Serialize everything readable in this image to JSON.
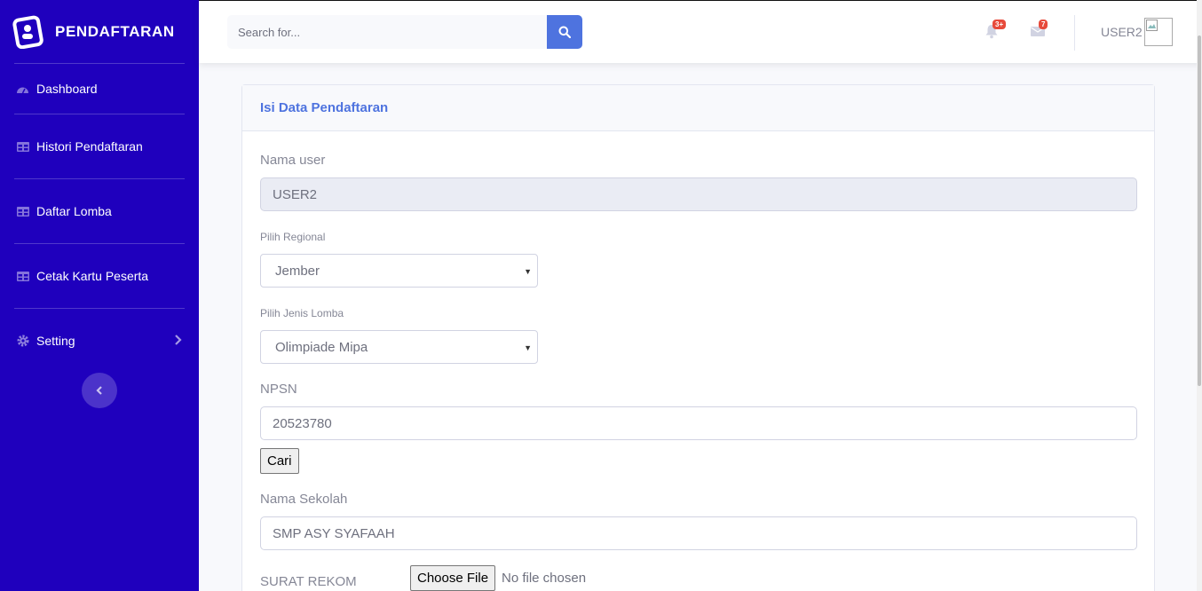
{
  "brand": {
    "name": "PENDAFTARAN",
    "icon": "brand-id-card-icon"
  },
  "sidebar": {
    "items": [
      {
        "label": "Dashboard",
        "icon": "tachometer-icon"
      },
      {
        "label": "Histori Pendaftaran",
        "icon": "table-icon"
      },
      {
        "label": "Daftar Lomba",
        "icon": "table-icon"
      },
      {
        "label": "Cetak Kartu Peserta",
        "icon": "table-icon"
      },
      {
        "label": "Setting",
        "icon": "cog-icon"
      }
    ],
    "toggle_icon": "chevron-left-icon"
  },
  "topbar": {
    "search_placeholder": "Search for...",
    "alerts_badge": "3+",
    "messages_badge": "7",
    "username": "USER2"
  },
  "card": {
    "title": "Isi Data Pendaftaran",
    "nama_user_label": "Nama user",
    "nama_user_value": "USER2",
    "regional_label": "Pilih Regional",
    "regional_value": "Jember",
    "jenis_lomba_label": "Pilih Jenis Lomba",
    "jenis_lomba_value": "Olimpiade Mipa",
    "npsn_label": "NPSN",
    "npsn_value": "20523780",
    "cari_label": "Cari",
    "sekolah_label": "Nama Sekolah",
    "sekolah_value": "SMP ASY SYAFAAH",
    "surat_label": "SURAT REKOM",
    "file_button": "Choose File",
    "file_status": "No file chosen"
  },
  "colors": {
    "sidebar": "#1f00bd",
    "primary": "#4e73df",
    "danger": "#e74a3b"
  }
}
